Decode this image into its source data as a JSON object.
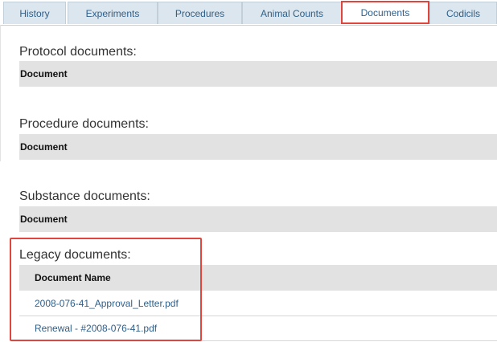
{
  "tabs": [
    {
      "label": "History"
    },
    {
      "label": "Experiments"
    },
    {
      "label": "Procedures"
    },
    {
      "label": "Animal Counts"
    },
    {
      "label": "Documents",
      "active": true
    },
    {
      "label": "Codicils"
    }
  ],
  "sections": {
    "protocol": {
      "title": "Protocol documents:",
      "column": "Document"
    },
    "procedure": {
      "title": "Procedure documents:",
      "column": "Document"
    },
    "substance": {
      "title": "Substance documents:",
      "column": "Document"
    },
    "legacy": {
      "title": "Legacy documents:",
      "column": "Document Name",
      "rows": [
        {
          "name": "2008-076-41_Approval_Letter.pdf"
        },
        {
          "name": "Renewal - #2008-076-41.pdf"
        }
      ]
    }
  },
  "colors": {
    "accent": "#e0463e",
    "link": "#2f5f8a",
    "header_bg": "#e2e2e2",
    "tab_bg": "#dbe6ee"
  }
}
